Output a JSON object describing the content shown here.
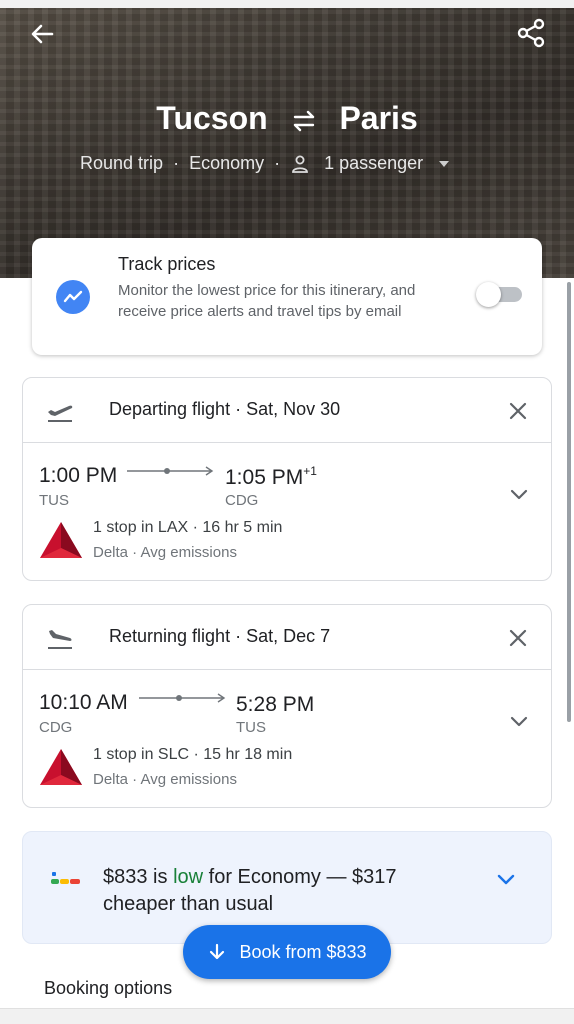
{
  "header": {
    "origin": "Tucson",
    "destination": "Paris",
    "trip_type": "Round trip",
    "cabin": "Economy",
    "passengers": "1 passenger"
  },
  "track_prices": {
    "title": "Track prices",
    "description": "Monitor the lowest price for this itinerary, and receive price alerts and travel tips by email",
    "enabled": false
  },
  "flights": [
    {
      "title": "Departing flight · Sat, Nov 30",
      "depart_time": "1:00 PM",
      "depart_code": "TUS",
      "arrive_time": "1:05 PM",
      "arrive_suffix": "+1",
      "arrive_code": "CDG",
      "stops": "1 stop in LAX · 16 hr 5 min",
      "carrier": "Delta · Avg emissions"
    },
    {
      "title": "Returning flight · Sat, Dec 7",
      "depart_time": "10:10 AM",
      "depart_code": "CDG",
      "arrive_time": "5:28 PM",
      "arrive_suffix": "",
      "arrive_code": "TUS",
      "stops": "1 stop in SLC · 15 hr 18 min",
      "carrier": "Delta · Avg emissions"
    }
  ],
  "price_insight": {
    "prefix": "$833 is",
    "level": "low",
    "suffix": "for Economy — $317 cheaper than usual",
    "level_color": "#188038"
  },
  "actions": {
    "book_label": "Book from $833",
    "booking_options": "Booking options"
  },
  "colors": {
    "accent": "#1a73e8",
    "delta_red": "#c8102e"
  },
  "icons": [
    "back-arrow-icon",
    "share-icon",
    "swap-arrows-icon",
    "person-icon",
    "trend-chart-icon",
    "takeoff-icon",
    "landing-icon",
    "close-icon",
    "chevron-down-icon",
    "delta-logo",
    "price-bars-icon",
    "arrow-down-icon"
  ]
}
